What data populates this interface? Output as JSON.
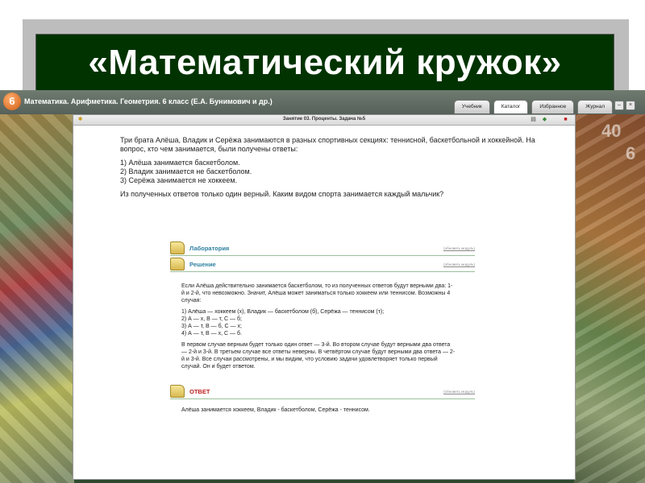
{
  "slide": {
    "title": "«Математический кружок»"
  },
  "app": {
    "logo": "6",
    "title": "Математика. Арифметика. Геометрия. 6 класс (Е.А. Бунимович и др.)",
    "tabs": [
      {
        "label": "Учебник",
        "active": false
      },
      {
        "label": "Каталог",
        "active": true
      },
      {
        "label": "Избранное",
        "active": false
      },
      {
        "label": "Журнал",
        "active": false
      }
    ]
  },
  "lesson": {
    "title": "Занятие 03. Проценты. Задача №5"
  },
  "problem": {
    "text": "Три брата Алёша, Владик и Серёжа занимаются в разных спортивных секциях: теннисной, баскетбольной и хоккейной. На вопрос, кто чем занимается, были получены ответы:",
    "answers": [
      "1) Алёша занимается баскетболом.",
      "2) Владик занимается не баскетболом.",
      "3) Серёжа занимается не хоккеем."
    ],
    "question": "Из полученных ответов только один верный. Каким видом спорта занимается каждый мальчик?"
  },
  "sections": {
    "lab_label": "Лаборатория",
    "lab_link": "(обновить модуль)",
    "solution_label": "Решение",
    "solution_link": "(обновить модуль)",
    "answer_label": "ОТВЕТ",
    "answer_link": "(обновить модуль)"
  },
  "solution": {
    "p1": "Если Алёша действительно занимается баскетболом, то из полученных ответов будут верными два: 1-й и 2-й, что невозможно. Значит, Алёша может заниматься только хоккеем или теннисом. Возможны 4 случая:",
    "cases": [
      "1)  Алёша — хоккеем (х), Владик — баскетболом (б), Серёжа — теннисом (т);",
      "2)  А — х, В — т, С — б;",
      "3)  А — т, В — б, С — х;",
      "4)  А — т, В — х, С — б."
    ],
    "p2": "В первом случае верным будет только один ответ — 3-й. Во втором случае будут верными два ответа — 2-й и 3-й. В третьем случае все ответы неверны. В четвёртом случае будут верными два ответа — 2-й и 3-й. Все случаи рассмотрены, и мы видим, что условию задачи удовлетворяет только первый случай. Он и будет ответом."
  },
  "answer": {
    "text": "Алёша занимается хоккеем, Владик - баскетболом, Серёжа - теннисом."
  },
  "decor": {
    "num1": "40",
    "num2": "6"
  }
}
